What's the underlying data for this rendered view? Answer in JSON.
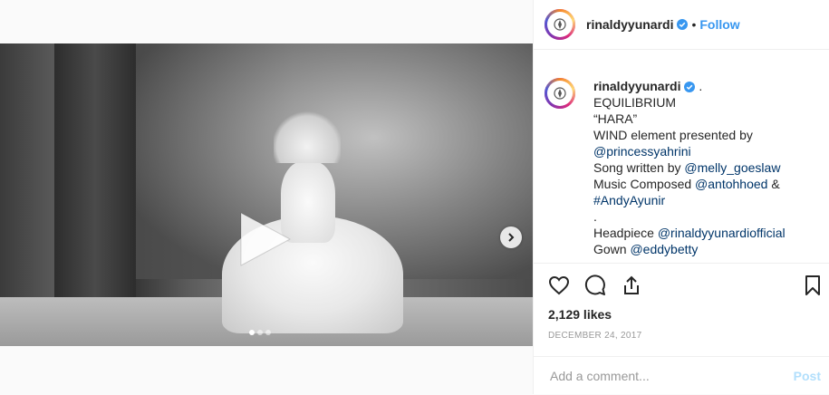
{
  "header": {
    "username": "rinaldyyunardi",
    "separator": "•",
    "follow_label": "Follow"
  },
  "caption": {
    "username": "rinaldyyunardi",
    "lines": [
      {
        "text": "EQUILIBRIUM"
      },
      {
        "text": "“HARA”"
      },
      {
        "text": "WIND element presented by"
      },
      {
        "mention": "@princessyahrini"
      },
      {
        "text": "Song written by ",
        "mention": "@melly_goeslaw"
      },
      {
        "text": "Music Composed ",
        "mention": "@antohhoed",
        "after": " &"
      },
      {
        "mention": "#AndyAyunir"
      },
      {
        "text": "."
      },
      {
        "text": "Headpiece ",
        "mention": "@rinaldyyunardiofficial"
      },
      {
        "text": "Gown ",
        "mention": "@eddybetty"
      }
    ],
    "first_line_suffix": "."
  },
  "media": {
    "carousel_dots": 3,
    "active_dot": 0
  },
  "engagement": {
    "likes": "2,129 likes",
    "date": "DECEMBER 24, 2017"
  },
  "comment": {
    "placeholder": "Add a comment...",
    "post_label": "Post"
  },
  "colors": {
    "link": "#3897f0",
    "mention": "#003569",
    "post_disabled": "#b2dffc"
  },
  "icons": [
    "heart-icon",
    "comment-icon",
    "share-icon",
    "bookmark-icon",
    "play-icon",
    "chevron-right-icon",
    "verified-badge-icon"
  ]
}
